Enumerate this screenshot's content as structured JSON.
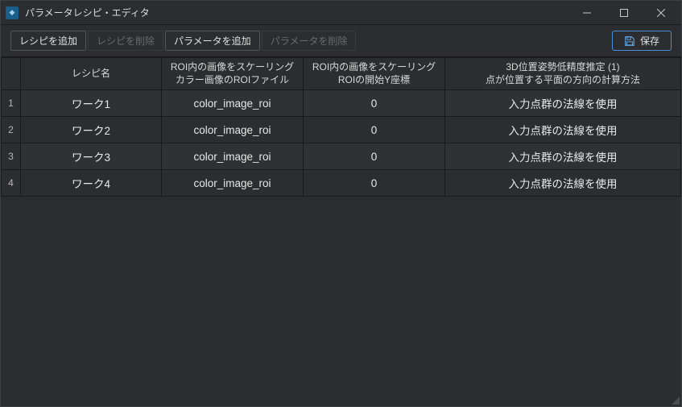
{
  "window": {
    "title": "パラメータレシピ・エディタ"
  },
  "toolbar": {
    "add_recipe": "レシピを追加",
    "delete_recipe": "レシピを削除",
    "add_param": "パラメータを追加",
    "delete_param": "パラメータを削除",
    "save": "保存"
  },
  "table": {
    "headers": {
      "recipe_name": "レシピ名",
      "col2_l1": "ROI内の画像をスケーリング",
      "col2_l2": "カラー画像のROIファイル",
      "col3_l1": "ROI内の画像をスケーリング",
      "col3_l2": "ROIの開始Y座標",
      "col4_l1": "3D位置姿勢低精度推定 (1)",
      "col4_l2": "点が位置する平面の方向の計算方法"
    },
    "rows": [
      {
        "idx": "1",
        "name": "ワーク1",
        "c2": "color_image_roi",
        "c3": "0",
        "c4": "入力点群の法線を使用"
      },
      {
        "idx": "2",
        "name": "ワーク2",
        "c2": "color_image_roi",
        "c3": "0",
        "c4": "入力点群の法線を使用"
      },
      {
        "idx": "3",
        "name": "ワーク3",
        "c2": "color_image_roi",
        "c3": "0",
        "c4": "入力点群の法線を使用"
      },
      {
        "idx": "4",
        "name": "ワーク4",
        "c2": "color_image_roi",
        "c3": "0",
        "c4": "入力点群の法線を使用"
      }
    ]
  }
}
